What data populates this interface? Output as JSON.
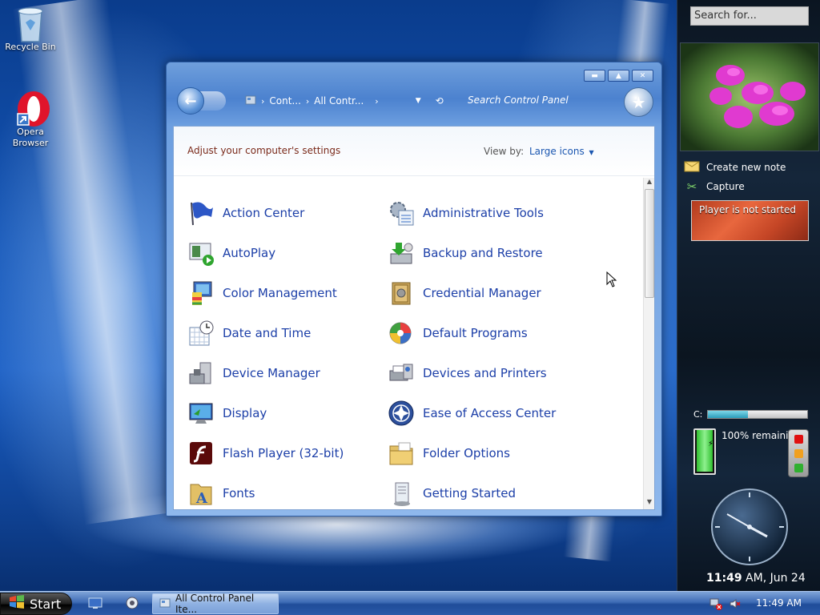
{
  "desktop": {
    "recycle_bin": "Recycle Bin",
    "opera": "Opera\nBrowser"
  },
  "window": {
    "breadcrumb": [
      "Cont...",
      "All Contr..."
    ],
    "search_placeholder": "Search Control Panel",
    "heading": "Adjust your computer's settings",
    "view_by_label": "View by:",
    "view_by_value": "Large icons",
    "items_left": [
      {
        "label": "Action Center",
        "icon": "flag-icon"
      },
      {
        "label": "AutoPlay",
        "icon": "autoplay-icon"
      },
      {
        "label": "Color Management",
        "icon": "color-management-icon"
      },
      {
        "label": "Date and Time",
        "icon": "calendar-clock-icon"
      },
      {
        "label": "Device Manager",
        "icon": "device-manager-icon"
      },
      {
        "label": "Display",
        "icon": "monitor-icon"
      },
      {
        "label": "Flash Player (32-bit)",
        "icon": "flash-icon"
      },
      {
        "label": "Fonts",
        "icon": "fonts-folder-icon"
      }
    ],
    "items_right": [
      {
        "label": "Administrative Tools",
        "icon": "admin-tools-icon"
      },
      {
        "label": "Backup and Restore",
        "icon": "backup-icon"
      },
      {
        "label": "Credential Manager",
        "icon": "vault-icon"
      },
      {
        "label": "Default Programs",
        "icon": "default-programs-icon"
      },
      {
        "label": "Devices and Printers",
        "icon": "printer-icon"
      },
      {
        "label": "Ease of Access Center",
        "icon": "ease-of-access-icon"
      },
      {
        "label": "Folder Options",
        "icon": "folder-icon"
      },
      {
        "label": "Getting Started",
        "icon": "getting-started-icon"
      }
    ]
  },
  "sidebar": {
    "search_placeholder": "Search for...",
    "create_note": "Create new note",
    "capture": "Capture",
    "player_status": "Player is not started",
    "disk_label": "C:",
    "disk_used_fraction": 0.4,
    "battery_text": "100% remaining",
    "battery_fraction": 1.0,
    "clock_time": "11:49",
    "clock_suffix": "AM, Jun 24"
  },
  "taskbar": {
    "start_label": "Start",
    "task_label": "All Control Panel Ite...",
    "clock": "11:49 AM"
  },
  "colors": {
    "link_blue": "#1c3fa8",
    "heading_brown": "#7a2a1a"
  }
}
